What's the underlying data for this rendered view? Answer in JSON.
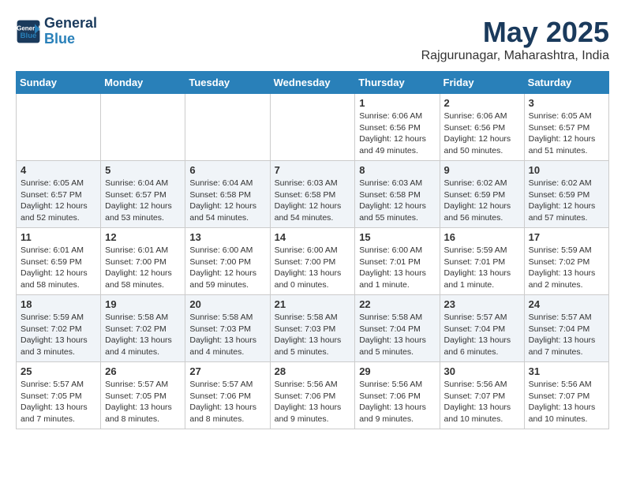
{
  "header": {
    "logo_line1": "General",
    "logo_line2": "Blue",
    "title": "May 2025",
    "subtitle": "Rajgurunagar, Maharashtra, India"
  },
  "days_of_week": [
    "Sunday",
    "Monday",
    "Tuesday",
    "Wednesday",
    "Thursday",
    "Friday",
    "Saturday"
  ],
  "weeks": [
    [
      {
        "num": "",
        "info": ""
      },
      {
        "num": "",
        "info": ""
      },
      {
        "num": "",
        "info": ""
      },
      {
        "num": "",
        "info": ""
      },
      {
        "num": "1",
        "info": "Sunrise: 6:06 AM\nSunset: 6:56 PM\nDaylight: 12 hours\nand 49 minutes."
      },
      {
        "num": "2",
        "info": "Sunrise: 6:06 AM\nSunset: 6:56 PM\nDaylight: 12 hours\nand 50 minutes."
      },
      {
        "num": "3",
        "info": "Sunrise: 6:05 AM\nSunset: 6:57 PM\nDaylight: 12 hours\nand 51 minutes."
      }
    ],
    [
      {
        "num": "4",
        "info": "Sunrise: 6:05 AM\nSunset: 6:57 PM\nDaylight: 12 hours\nand 52 minutes."
      },
      {
        "num": "5",
        "info": "Sunrise: 6:04 AM\nSunset: 6:57 PM\nDaylight: 12 hours\nand 53 minutes."
      },
      {
        "num": "6",
        "info": "Sunrise: 6:04 AM\nSunset: 6:58 PM\nDaylight: 12 hours\nand 54 minutes."
      },
      {
        "num": "7",
        "info": "Sunrise: 6:03 AM\nSunset: 6:58 PM\nDaylight: 12 hours\nand 54 minutes."
      },
      {
        "num": "8",
        "info": "Sunrise: 6:03 AM\nSunset: 6:58 PM\nDaylight: 12 hours\nand 55 minutes."
      },
      {
        "num": "9",
        "info": "Sunrise: 6:02 AM\nSunset: 6:59 PM\nDaylight: 12 hours\nand 56 minutes."
      },
      {
        "num": "10",
        "info": "Sunrise: 6:02 AM\nSunset: 6:59 PM\nDaylight: 12 hours\nand 57 minutes."
      }
    ],
    [
      {
        "num": "11",
        "info": "Sunrise: 6:01 AM\nSunset: 6:59 PM\nDaylight: 12 hours\nand 58 minutes."
      },
      {
        "num": "12",
        "info": "Sunrise: 6:01 AM\nSunset: 7:00 PM\nDaylight: 12 hours\nand 58 minutes."
      },
      {
        "num": "13",
        "info": "Sunrise: 6:00 AM\nSunset: 7:00 PM\nDaylight: 12 hours\nand 59 minutes."
      },
      {
        "num": "14",
        "info": "Sunrise: 6:00 AM\nSunset: 7:00 PM\nDaylight: 13 hours\nand 0 minutes."
      },
      {
        "num": "15",
        "info": "Sunrise: 6:00 AM\nSunset: 7:01 PM\nDaylight: 13 hours\nand 1 minute."
      },
      {
        "num": "16",
        "info": "Sunrise: 5:59 AM\nSunset: 7:01 PM\nDaylight: 13 hours\nand 1 minute."
      },
      {
        "num": "17",
        "info": "Sunrise: 5:59 AM\nSunset: 7:02 PM\nDaylight: 13 hours\nand 2 minutes."
      }
    ],
    [
      {
        "num": "18",
        "info": "Sunrise: 5:59 AM\nSunset: 7:02 PM\nDaylight: 13 hours\nand 3 minutes."
      },
      {
        "num": "19",
        "info": "Sunrise: 5:58 AM\nSunset: 7:02 PM\nDaylight: 13 hours\nand 4 minutes."
      },
      {
        "num": "20",
        "info": "Sunrise: 5:58 AM\nSunset: 7:03 PM\nDaylight: 13 hours\nand 4 minutes."
      },
      {
        "num": "21",
        "info": "Sunrise: 5:58 AM\nSunset: 7:03 PM\nDaylight: 13 hours\nand 5 minutes."
      },
      {
        "num": "22",
        "info": "Sunrise: 5:58 AM\nSunset: 7:04 PM\nDaylight: 13 hours\nand 5 minutes."
      },
      {
        "num": "23",
        "info": "Sunrise: 5:57 AM\nSunset: 7:04 PM\nDaylight: 13 hours\nand 6 minutes."
      },
      {
        "num": "24",
        "info": "Sunrise: 5:57 AM\nSunset: 7:04 PM\nDaylight: 13 hours\nand 7 minutes."
      }
    ],
    [
      {
        "num": "25",
        "info": "Sunrise: 5:57 AM\nSunset: 7:05 PM\nDaylight: 13 hours\nand 7 minutes."
      },
      {
        "num": "26",
        "info": "Sunrise: 5:57 AM\nSunset: 7:05 PM\nDaylight: 13 hours\nand 8 minutes."
      },
      {
        "num": "27",
        "info": "Sunrise: 5:57 AM\nSunset: 7:06 PM\nDaylight: 13 hours\nand 8 minutes."
      },
      {
        "num": "28",
        "info": "Sunrise: 5:56 AM\nSunset: 7:06 PM\nDaylight: 13 hours\nand 9 minutes."
      },
      {
        "num": "29",
        "info": "Sunrise: 5:56 AM\nSunset: 7:06 PM\nDaylight: 13 hours\nand 9 minutes."
      },
      {
        "num": "30",
        "info": "Sunrise: 5:56 AM\nSunset: 7:07 PM\nDaylight: 13 hours\nand 10 minutes."
      },
      {
        "num": "31",
        "info": "Sunrise: 5:56 AM\nSunset: 7:07 PM\nDaylight: 13 hours\nand 10 minutes."
      }
    ]
  ]
}
